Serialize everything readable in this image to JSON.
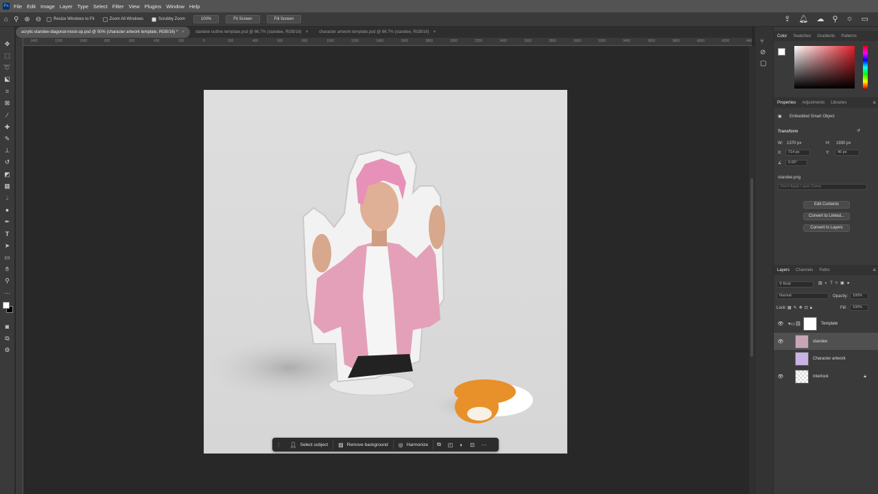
{
  "menu": [
    "File",
    "Edit",
    "Image",
    "Layer",
    "Type",
    "Select",
    "Filter",
    "View",
    "Plugins",
    "Window",
    "Help"
  ],
  "app_logo": "Ps",
  "options": {
    "resize_windows": "Resize Windows to Fit",
    "zoom_all": "Zoom All Windows",
    "scrubby_zoom": "Scrubby Zoom",
    "zoom_value": "100%",
    "fit_screen": "Fit Screen",
    "fill_screen": "Fill Screen"
  },
  "tabs": [
    {
      "label": "acrylic-standee-diagonal-mock-up.psd @ 50% (character artwork template, RGB/16) *",
      "active": true
    },
    {
      "label": "standee outline template.psd @ 66.7% (standee, RGB/16)",
      "active": false
    },
    {
      "label": "character artwork template.psd @ 66.7% (standee, RGB/16)",
      "active": false
    }
  ],
  "ruler_ticks": [
    "1400",
    "1200",
    "1000",
    "800",
    "600",
    "400",
    "200",
    "0",
    "200",
    "400",
    "600",
    "800",
    "1000",
    "1200",
    "1400",
    "1600",
    "1800",
    "2000",
    "2200",
    "2400",
    "2600",
    "2800",
    "3000",
    "3200",
    "3400",
    "3600",
    "3800",
    "4000",
    "4200",
    "4400"
  ],
  "context_bar": {
    "select_subject": "Select subject",
    "remove_background": "Remove background",
    "harmonize": "Harmonize"
  },
  "color_panel": {
    "tabs": [
      "Color",
      "Swatches",
      "Gradients",
      "Patterns"
    ]
  },
  "properties": {
    "tabs": [
      "Properties",
      "Adjustments",
      "Libraries"
    ],
    "type": "Embedded Smart Object",
    "transform_label": "Transform",
    "w_label": "W:",
    "w": "1370 px",
    "h_label": "H:",
    "h": "1930 px",
    "x_label": "X:",
    "x": "714 px",
    "y_label": "Y:",
    "y": "46 px",
    "angle": "0.00°",
    "filename": "standee.png",
    "layer_comp": "Don't Apply Layer Comp",
    "edit_contents": "Edit Contents",
    "convert_linked": "Convert to Linked...",
    "convert_layers": "Convert to Layers"
  },
  "layers_panel": {
    "tabs": [
      "Layers",
      "Channels",
      "Paths"
    ],
    "kind": "Kind",
    "blend": "Normal",
    "opacity_label": "Opacity:",
    "opacity": "100%",
    "lock_label": "Lock:",
    "fill_label": "Fill:",
    "fill": "100%",
    "layers": [
      {
        "name": "Template",
        "visible": true,
        "selected": false
      },
      {
        "name": "standee",
        "visible": true,
        "selected": true
      },
      {
        "name": "Character artwork",
        "visible": false,
        "selected": false
      },
      {
        "name": "Interlock",
        "visible": true,
        "selected": false,
        "locked": true
      }
    ]
  },
  "colors": {
    "accent": "#31a8ff",
    "ui_bg": "#282828",
    "panel": "#3a3a3a",
    "selected_layer": "#505050"
  }
}
